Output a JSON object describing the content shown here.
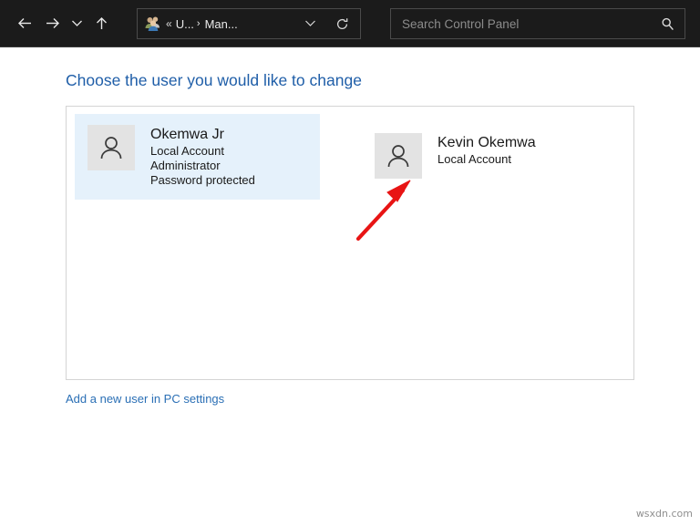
{
  "toolbar": {
    "back_label": "Back",
    "forward_label": "Forward",
    "recent_label": "Recent locations",
    "up_label": "Up one level",
    "address": {
      "icon_name": "user-accounts-icon",
      "separator": "«",
      "crumb_1": "U...",
      "crumb_arrow": "›",
      "crumb_2": "Man...",
      "dropdown_glyph": "∨",
      "refresh_label": "Refresh"
    },
    "search": {
      "placeholder": "Search Control Panel",
      "value": ""
    }
  },
  "main": {
    "title": "Choose the user you would like to change",
    "add_user_link": "Add a new user in PC settings",
    "users": [
      {
        "name": "Okemwa Jr",
        "account_type": "Local Account",
        "role": "Administrator",
        "password_status": "Password protected",
        "selected": true
      },
      {
        "name": "Kevin Okemwa",
        "account_type": "Local Account",
        "role": "",
        "password_status": "",
        "selected": false
      }
    ]
  },
  "annotation": {
    "arrow_color": "#e81414",
    "points_to": "Kevin Okemwa"
  },
  "watermark": "wsxdn.com",
  "colors": {
    "toolbar_bg": "#1b1b1b",
    "selection_bg": "#e5f1fb",
    "title_blue": "#1f5ea8",
    "link_blue": "#2a6fb5",
    "avatar_bg": "#e3e3e3"
  }
}
